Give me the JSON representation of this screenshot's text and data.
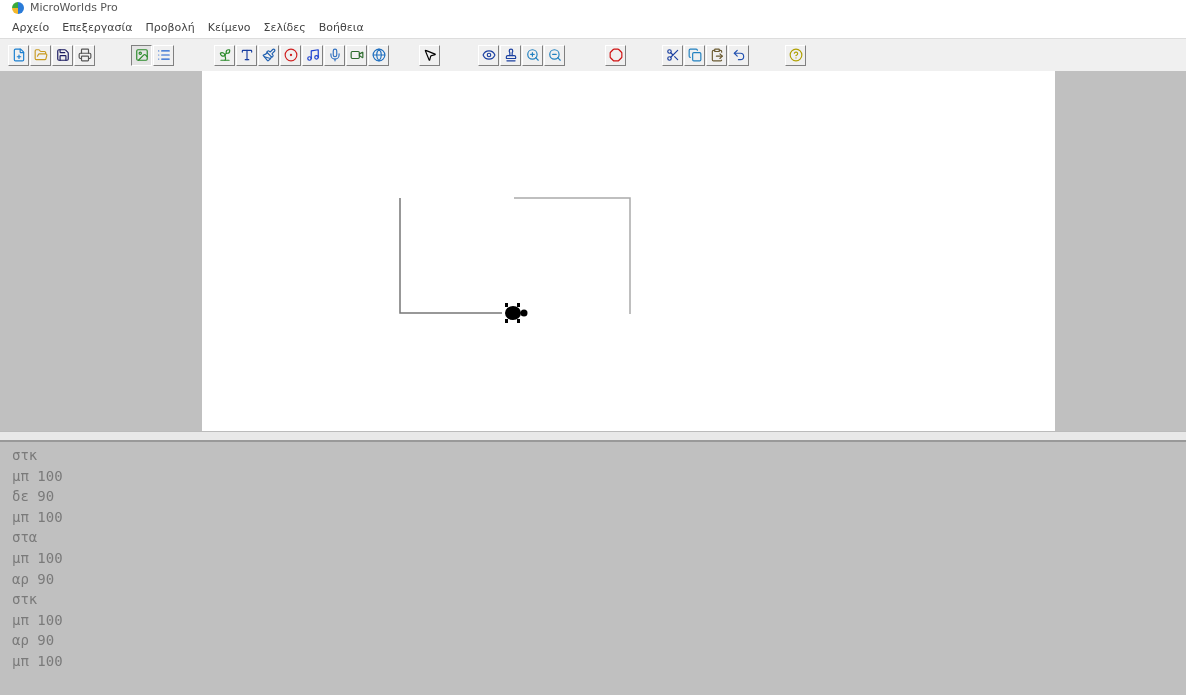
{
  "window": {
    "title": "MicroWorlds Pro"
  },
  "menu": [
    "Αρχείο",
    "Επεξεργασία",
    "Προβολή",
    "Κείμενο",
    "Σελίδες",
    "Βοήθεια"
  ],
  "view_buttons": [
    {
      "selected": true
    },
    {
      "selected": false
    }
  ],
  "command_center": {
    "lines": [
      "στκ",
      "μπ 100",
      "δε 90",
      "μπ 100",
      "στα",
      "μπ 100",
      "αρ 90",
      "στκ",
      "μπ 100",
      "αρ 90",
      "μπ 100"
    ]
  }
}
